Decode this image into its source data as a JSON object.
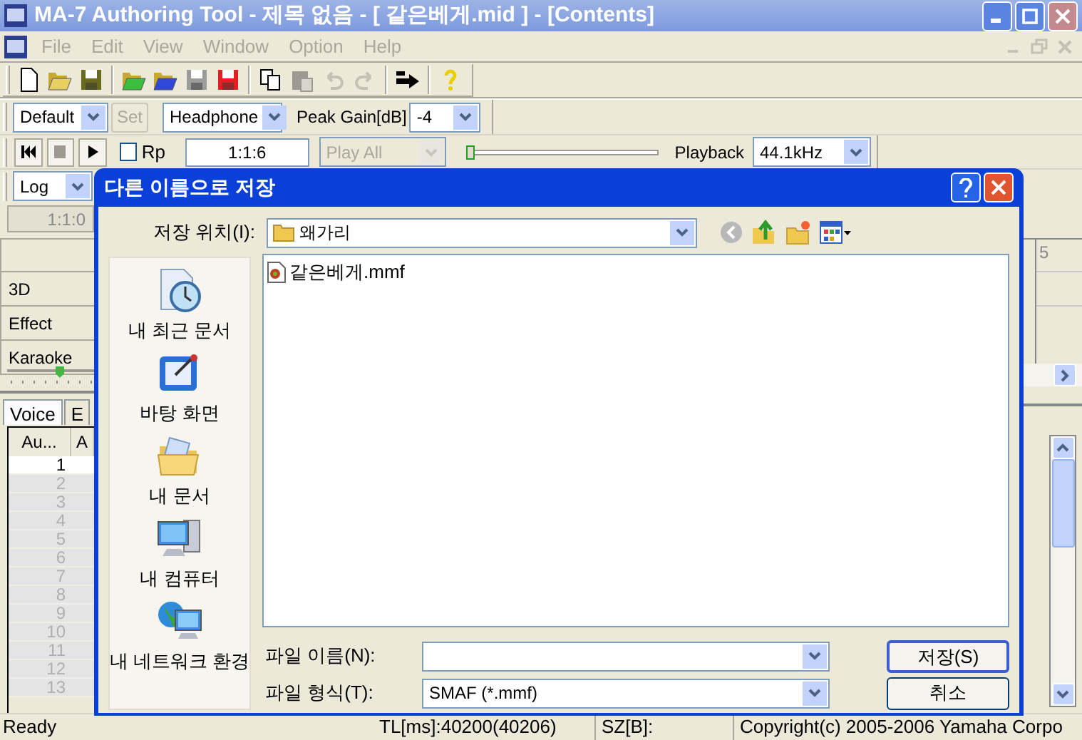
{
  "window": {
    "title": "MA-7 Authoring Tool - 제목 없음 - [ 같은베게.mid ] - [Contents]"
  },
  "menu": [
    {
      "label": "File",
      "disabled": true
    },
    {
      "label": "Edit",
      "disabled": true
    },
    {
      "label": "View",
      "disabled": true
    },
    {
      "label": "Window",
      "disabled": true
    },
    {
      "label": "Option",
      "disabled": true
    },
    {
      "label": "Help",
      "disabled": true
    }
  ],
  "settings_bar": {
    "preset": "Default",
    "set_button": {
      "label": "Set",
      "disabled": true
    },
    "output": "Headphone",
    "peak_gain_label": "Peak Gain[dB]",
    "peak_gain": "-4"
  },
  "transport": {
    "repeat": {
      "label": "Rp",
      "checked": false
    },
    "position": "1:1:6",
    "play_mode": {
      "value": "Play All",
      "disabled": true
    },
    "volume": {
      "level": 0
    },
    "playback_label": "Playback",
    "playback_rate": "44.1kHz"
  },
  "scale": "Log",
  "left_panel": {
    "time": "1:1:0",
    "rows": [
      "3D",
      "Effect",
      "Karaoke"
    ]
  },
  "tabs": [
    {
      "label": "Voice",
      "selected": true
    },
    {
      "label": "E",
      "selected": false
    }
  ],
  "table": {
    "columns": [
      "Au...",
      "A"
    ],
    "rows": [
      {
        "number": "1",
        "filled": true
      },
      {
        "number": "2",
        "filled": false
      },
      {
        "number": "3",
        "filled": false
      },
      {
        "number": "4",
        "filled": false
      },
      {
        "number": "5",
        "filled": false
      },
      {
        "number": "6",
        "filled": false
      },
      {
        "number": "7",
        "filled": false
      },
      {
        "number": "8",
        "filled": false
      },
      {
        "number": "9",
        "filled": false
      },
      {
        "number": "10",
        "filled": false
      },
      {
        "number": "11",
        "filled": false
      },
      {
        "number": "12",
        "filled": false
      },
      {
        "number": "13",
        "filled": false
      }
    ]
  },
  "ruler": {
    "label": "5"
  },
  "status_bar": {
    "message": "Ready",
    "time": "TL[ms]:40200(40206)",
    "size": "SZ[B]:",
    "copyright": "Copyright(c) 2005-2006 Yamaha Corpo"
  },
  "dialog": {
    "title": "다른 이름으로 저장",
    "location_label": "저장 위치(I):",
    "location": "왜가리",
    "places": [
      {
        "kind": "recent",
        "label": "내 최근 문서"
      },
      {
        "kind": "desktop",
        "label": "바탕 화면"
      },
      {
        "kind": "documents",
        "label": "내 문서"
      },
      {
        "kind": "computer",
        "label": "내 컴퓨터"
      },
      {
        "kind": "network",
        "label": "내 네트워크 환경"
      }
    ],
    "files": [
      {
        "name": "같은베게.mmf",
        "selected": false
      }
    ],
    "file_name_label": "파일 이름(N):",
    "file_type_label": "파일 형식(T):",
    "file_type": "SMAF (*.mmf)",
    "buttons": [
      {
        "label": "저장(S)",
        "default": true
      },
      {
        "label": "취소",
        "default": false
      }
    ]
  }
}
